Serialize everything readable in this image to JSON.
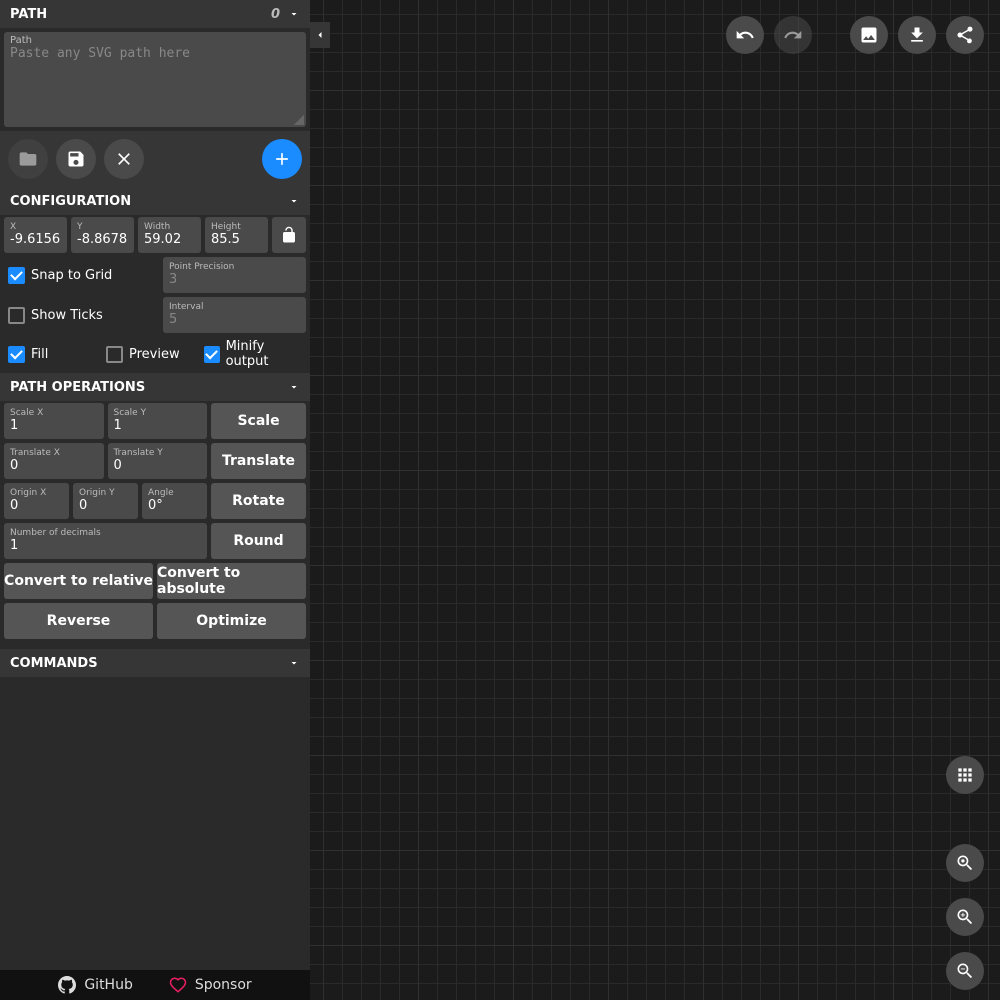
{
  "panels": {
    "path": {
      "title": "PATH",
      "count": "0",
      "textareaLabel": "Path",
      "placeholder": "Paste any SVG path here"
    },
    "config": {
      "title": "CONFIGURATION",
      "x": {
        "label": "X",
        "value": "-9.6156"
      },
      "y": {
        "label": "Y",
        "value": "-8.8678"
      },
      "width": {
        "label": "Width",
        "value": "59.02"
      },
      "height": {
        "label": "Height",
        "value": "85.5"
      },
      "snap": "Snap to Grid",
      "precision": {
        "label": "Point Precision",
        "value": "3"
      },
      "ticks": "Show Ticks",
      "interval": {
        "label": "Interval",
        "value": "5"
      },
      "fill": "Fill",
      "preview": "Preview",
      "minify": "Minify output"
    },
    "ops": {
      "title": "PATH OPERATIONS",
      "scaleX": {
        "label": "Scale X",
        "value": "1"
      },
      "scaleY": {
        "label": "Scale Y",
        "value": "1"
      },
      "scale": "Scale",
      "translateX": {
        "label": "Translate X",
        "value": "0"
      },
      "translateY": {
        "label": "Translate Y",
        "value": "0"
      },
      "translate": "Translate",
      "originX": {
        "label": "Origin X",
        "value": "0"
      },
      "originY": {
        "label": "Origin Y",
        "value": "0"
      },
      "angle": {
        "label": "Angle",
        "value": "0°"
      },
      "rotate": "Rotate",
      "decimals": {
        "label": "Number of decimals",
        "value": "1"
      },
      "round": "Round",
      "convertRel": "Convert to relative",
      "convertAbs": "Convert to absolute",
      "reverse": "Reverse",
      "optimize": "Optimize"
    },
    "commands": {
      "title": "COMMANDS"
    }
  },
  "footer": {
    "github": "GitHub",
    "sponsor": "Sponsor"
  }
}
